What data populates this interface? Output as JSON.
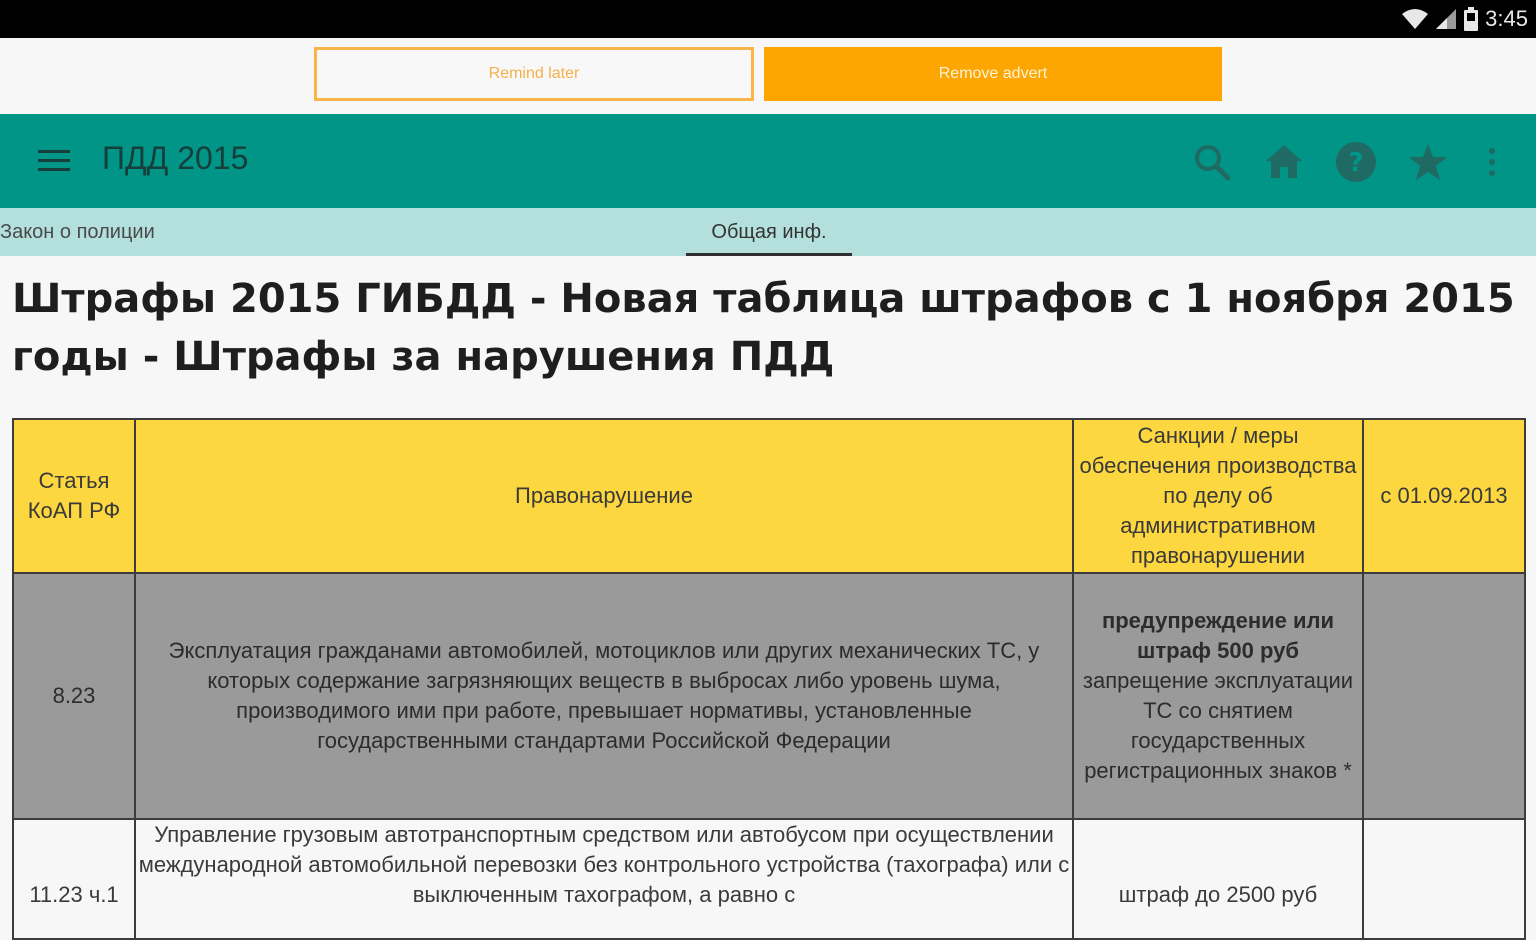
{
  "status_bar": {
    "time": "3:45"
  },
  "ad_bar": {
    "remind_label": "Remind later",
    "remove_label": "Remove advert"
  },
  "app_bar": {
    "title": "ПДД 2015"
  },
  "tabs": [
    {
      "label": "Закон о полиции"
    },
    {
      "label": "Общая инф."
    }
  ],
  "page": {
    "title": "Штрафы 2015 ГИБДД - Новая таблица штрафов с 1 ноября 2015 годы - Штрафы за нарушения ПДД"
  },
  "table": {
    "headers": [
      "Статья КоАП РФ",
      "Правонарушение",
      "Санкции / меры обеспечения производства по делу об административном правонарушении",
      "с 01.09.2013"
    ],
    "rows": [
      {
        "article": "8.23",
        "offense": "Эксплуатация гражданами автомобилей, мотоциклов или других механических ТС, у которых содержание загрязняющих веществ в выбросах либо уровень шума, производимого ими при работе, превышает нормативы, установленные государственными стандартами Российской Федерации",
        "sanction_bold": "предупреждение или штраф 500 руб",
        "sanction_extra": "запрещение эксплуатации ТС со снятием государственных регистрационных знаков *",
        "since": ""
      },
      {
        "article": "11.23 ч.1",
        "offense": "Управление грузовым автотранспортным средством или автобусом при осуществлении международной автомобильной перевозки без контрольного устройства (тахографа) или с выключенным тахографом, а равно с",
        "sanction_bold": "",
        "sanction_extra": "штраф до 2500 руб",
        "since": ""
      }
    ]
  },
  "colors": {
    "status_bar": "#000000",
    "app_bar": "#009587",
    "tab_bar": "#b3e0dc",
    "ad_accent": "#fda500",
    "table_header": "#fcd73f",
    "highlighted_row": "#9a9a9a"
  }
}
